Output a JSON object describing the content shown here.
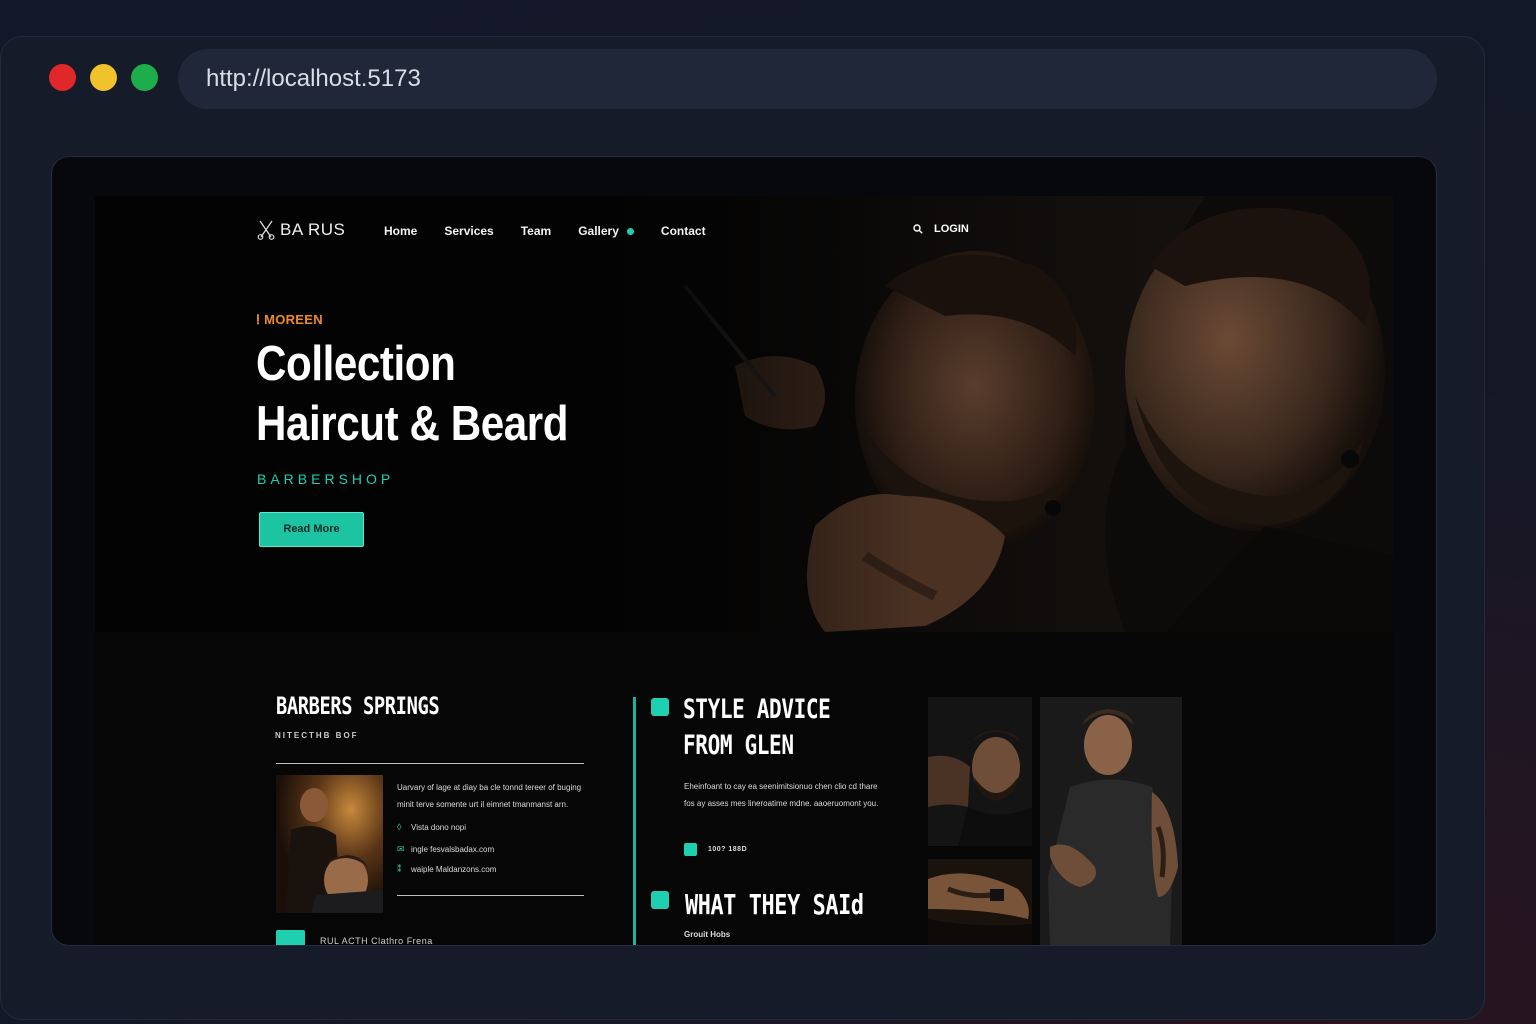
{
  "browser": {
    "url": "http://localhost.5173"
  },
  "nav": {
    "logo": "BA RUS",
    "items": [
      {
        "label": "Home"
      },
      {
        "label": "Services"
      },
      {
        "label": "Team"
      },
      {
        "label": "Gallery"
      },
      {
        "label": "Contact"
      }
    ],
    "login": "LOGIN"
  },
  "hero": {
    "eyebrow": "MOREEN",
    "title_line1": "Collection",
    "title_line2": "Haircut & Beard",
    "subtitle": "BARBERSHOP",
    "button": "Read More"
  },
  "col1": {
    "title": "BARBERS SPRINGS",
    "subtitle": "NITECTHB BOF",
    "description": "Uarvary of lage at diay ba cle tonnd tereer of buging minit terve somente urt il eimnet tmanmanst arn.",
    "contacts": [
      {
        "icon": "drop-icon",
        "text": "Vista dono nopi"
      },
      {
        "icon": "mail-icon",
        "text": "ingle fesvalsbadax.com"
      },
      {
        "icon": "link-icon",
        "text": "waiple Maldanzons.com"
      }
    ],
    "bottom_label": "RUL ACTH Clathro Frena"
  },
  "col2": {
    "title_line1": "STYLE ADVICE",
    "title_line2": "FROM GLEN",
    "description": "Eheinfoant to cay ea seenimitsionuo chen clio cd thare fos ay asses mes lineroatime mdne. aaoeruomont you.",
    "icon_text": "100? 188D",
    "title2": "WHAT THEY SAId",
    "subtitle2": "Grouit Hobs"
  },
  "colors": {
    "accent": "#1fd0b0",
    "eyebrow": "#ef8a2c",
    "background": "#060606"
  }
}
